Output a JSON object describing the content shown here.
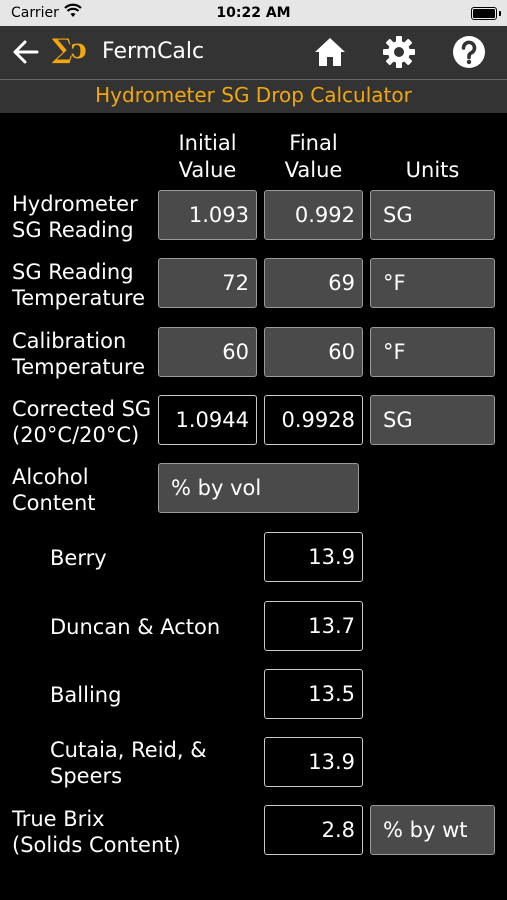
{
  "status": {
    "carrier": "Carrier",
    "time": "10:22 AM"
  },
  "nav": {
    "title": "FermCalc",
    "logo_text": "∑ↄ"
  },
  "page": {
    "subtitle": "Hydrometer SG Drop Calculator"
  },
  "headers": {
    "initial": "Initial\nValue",
    "final": "Final\nValue",
    "units": "Units"
  },
  "rows": {
    "hydrometer": {
      "label": "Hydrometer\nSG Reading",
      "initial": "1.093",
      "final": "0.992",
      "units": "SG"
    },
    "temperature": {
      "label": "SG Reading\nTemperature",
      "initial": "72",
      "final": "69",
      "units": "°F"
    },
    "calibration": {
      "label": "Calibration\nTemperature",
      "initial": "60",
      "final": "60",
      "units": "°F"
    },
    "corrected": {
      "label": "Corrected SG\n(20°C/20°C)",
      "initial": "1.0944",
      "final": "0.9928",
      "units": "SG"
    }
  },
  "alcohol": {
    "label": "Alcohol\nContent",
    "units": "% by vol",
    "methods": [
      {
        "label": "Berry",
        "value": "13.9"
      },
      {
        "label": "Duncan & Acton",
        "value": "13.7"
      },
      {
        "label": "Balling",
        "value": "13.5"
      },
      {
        "label": "Cutaia, Reid, &\nSpeers",
        "value": "13.9"
      }
    ]
  },
  "brix": {
    "label": "True Brix\n(Solids Content)",
    "value": "2.8",
    "units": "% by wt"
  },
  "colors": {
    "accent": "#f2a70c",
    "bar": "#333333",
    "field": "#4a4a4a"
  }
}
